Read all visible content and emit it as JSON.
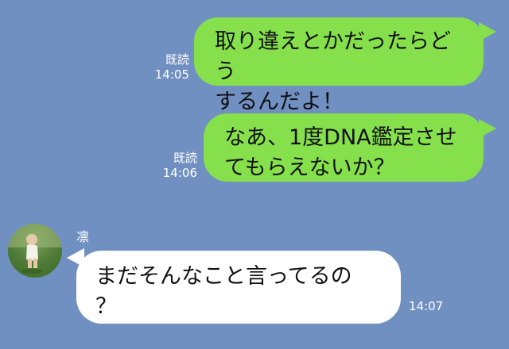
{
  "messages": [
    {
      "direction": "outgoing",
      "text": "取り違えとかだったらどう\nするんだよ！",
      "read_label": "既読",
      "time": "14:05"
    },
    {
      "direction": "outgoing",
      "text": "なあ、1度DNA鑑定させ\nてもらえないか？",
      "read_label": "既読",
      "time": "14:06"
    },
    {
      "direction": "incoming",
      "sender": "凛",
      "avatar": "child-photo-avatar",
      "text": "まだそんなこと言ってるの\n？",
      "time": "14:07"
    }
  ],
  "colors": {
    "background": "#7190c2",
    "outgoing_bubble": "#86e04c",
    "incoming_bubble": "#ffffff"
  }
}
